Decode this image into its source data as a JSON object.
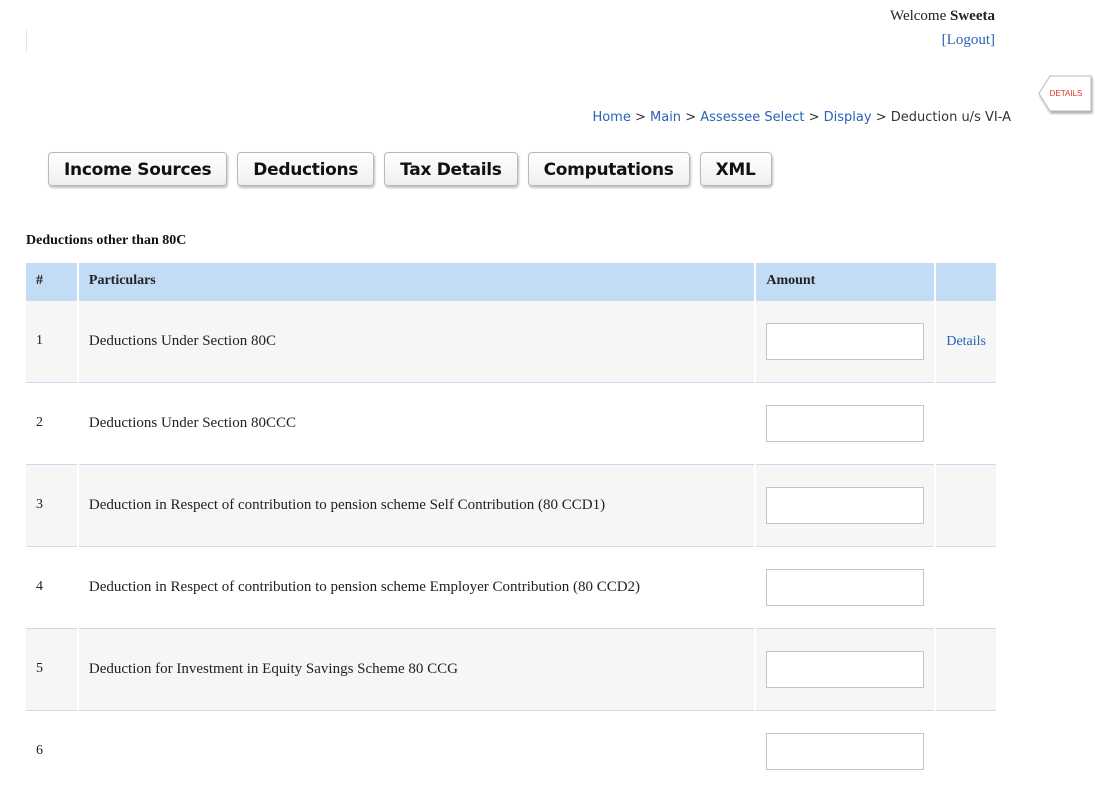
{
  "header": {
    "welcome_prefix": "Welcome",
    "user_name": "Sweeta",
    "logout_label": "[Logout]"
  },
  "side_tab": {
    "label": "DETAILS",
    "color": "#d83a2a"
  },
  "breadcrumb": {
    "items": [
      "Home",
      "Main",
      "Assessee Select",
      "Display"
    ],
    "separator": ">",
    "current": "Deduction u/s VI-A"
  },
  "tabs": [
    "Income Sources",
    "Deductions",
    "Tax Details",
    "Computations",
    "XML"
  ],
  "section": {
    "title": "Deductions other than 80C"
  },
  "table": {
    "headers": [
      "#",
      "Particulars",
      "Amount",
      ""
    ],
    "rows": [
      {
        "num": "1",
        "particulars": "Deductions Under Section 80C",
        "amount": "",
        "action": "Details"
      },
      {
        "num": "2",
        "particulars": "Deductions Under Section 80CCC",
        "amount": "",
        "action": ""
      },
      {
        "num": "3",
        "particulars": "Deduction in Respect of contribution to pension scheme Self Contribution (80 CCD1)",
        "amount": "",
        "action": ""
      },
      {
        "num": "4",
        "particulars": "Deduction in Respect of contribution to pension scheme Employer Contribution (80 CCD2)",
        "amount": "",
        "action": ""
      },
      {
        "num": "5",
        "particulars": "Deduction for Investment in Equity Savings Scheme 80 CCG",
        "amount": "",
        "action": ""
      },
      {
        "num": "6",
        "particulars": "",
        "amount": "",
        "action": ""
      }
    ]
  },
  "colors": {
    "link": "#2a62b8",
    "table_header_bg": "#c3dcf5",
    "row_alt_bg": "#f6f6f6"
  }
}
